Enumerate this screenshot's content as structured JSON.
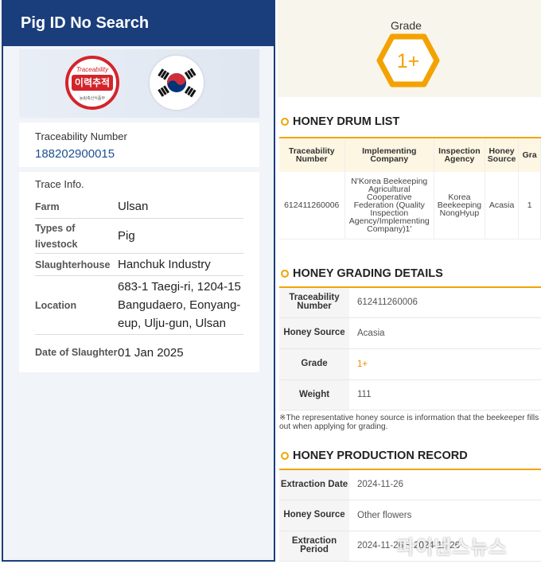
{
  "left": {
    "title": "Pig ID No Search",
    "logo": {
      "top_text": "Traceability",
      "korean_text": "이력추적",
      "bottom_text": "농림축산식품부"
    },
    "traceability_label": "Traceability Number",
    "traceability_number": "188202900015",
    "trace_info_title": "Trace Info.",
    "rows": [
      {
        "label": "Farm",
        "value": "Ulsan"
      },
      {
        "label": "Types of livestock",
        "value": "Pig"
      },
      {
        "label": "Slaughterhouse",
        "value": "Hanchuk Industry"
      },
      {
        "label": "Location",
        "value": "683-1 Taegi-ri, 1204-15 Bangudaero, Eonyang-eup, Ulju-gun, Ulsan"
      },
      {
        "label": "Date of Slaughter",
        "value": "01 Jan 2025"
      }
    ]
  },
  "right": {
    "grade_title": "Grade",
    "grade_value": "1+",
    "drum_list": {
      "title": "HONEY DRUM LIST",
      "headers": [
        "Traceability Number",
        "Implementing Company",
        "Inspection Agency",
        "Honey Source",
        "Gra"
      ],
      "row": [
        "612411260006",
        "N'Korea Beekeeping Agricultural Cooperative Federation (Quality Inspection Agency/Implementing Company)1'",
        "Korea Beekeeping NongHyup",
        "Acasia",
        "1"
      ]
    },
    "grading": {
      "title": "HONEY GRADING DETAILS",
      "rows": [
        {
          "label": "Traceability Number",
          "value": "612411260006"
        },
        {
          "label": "Honey Source",
          "value": "Acasia"
        },
        {
          "label": "Grade",
          "value": "1+"
        },
        {
          "label": "Weight",
          "value": "111"
        }
      ],
      "note": "※The representative honey source is information that the beekeeper fills out when applying for grading."
    },
    "production": {
      "title": "HONEY PRODUCTION RECORD",
      "rows": [
        {
          "label": "Extraction Date",
          "value": "2024-11-26"
        },
        {
          "label": "Honey Source",
          "value": "Other flowers"
        },
        {
          "label": "Extraction Period",
          "value": "2024-11-26 ~ 2024-11-26"
        }
      ]
    },
    "watermark": "파이낸스뉴스"
  },
  "colors": {
    "header_blue": "#1a3e7c",
    "accent_orange": "#f0a500",
    "logo_red": "#d4242b",
    "value_blue": "#1d4f91"
  },
  "icons": [
    "traceability-logo-icon",
    "korea-flag-icon",
    "grade-hexagon-icon",
    "section-bullet-icon"
  ]
}
